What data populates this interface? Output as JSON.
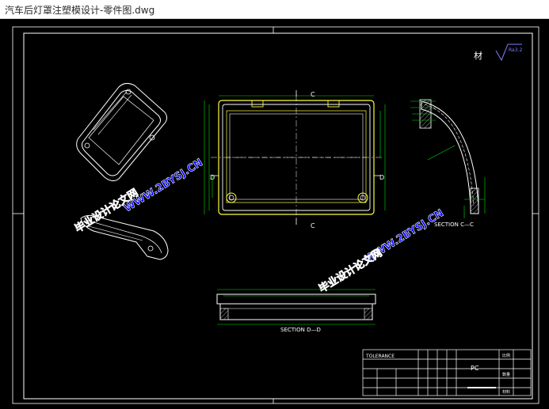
{
  "window": {
    "title": "汽车后灯罩注塑模设计-零件图.dwg"
  },
  "drawing": {
    "material_mark": "材",
    "roughness_value": "Ra3.2",
    "section_cc_label": "SECTION  C—C",
    "section_dd_label": "SECTION  D—D",
    "cut_letters": [
      "C",
      "C",
      "D",
      "D"
    ],
    "watermark_url": "WWW.2BYSJ.CN",
    "watermark_cn": "毕业设计论文网",
    "title_block": {
      "tolerance_header": "TOLERANCE",
      "material": "PC",
      "cells": [
        "比例",
        "数量",
        "材料"
      ]
    }
  },
  "colors": {
    "background": "#000000",
    "frame": "#ffffff",
    "part": "#ffffff",
    "dimension": "#00e000",
    "outline_yellow": "#ffff40",
    "watermark": "#0000ff",
    "roughness": "#8080ff"
  }
}
